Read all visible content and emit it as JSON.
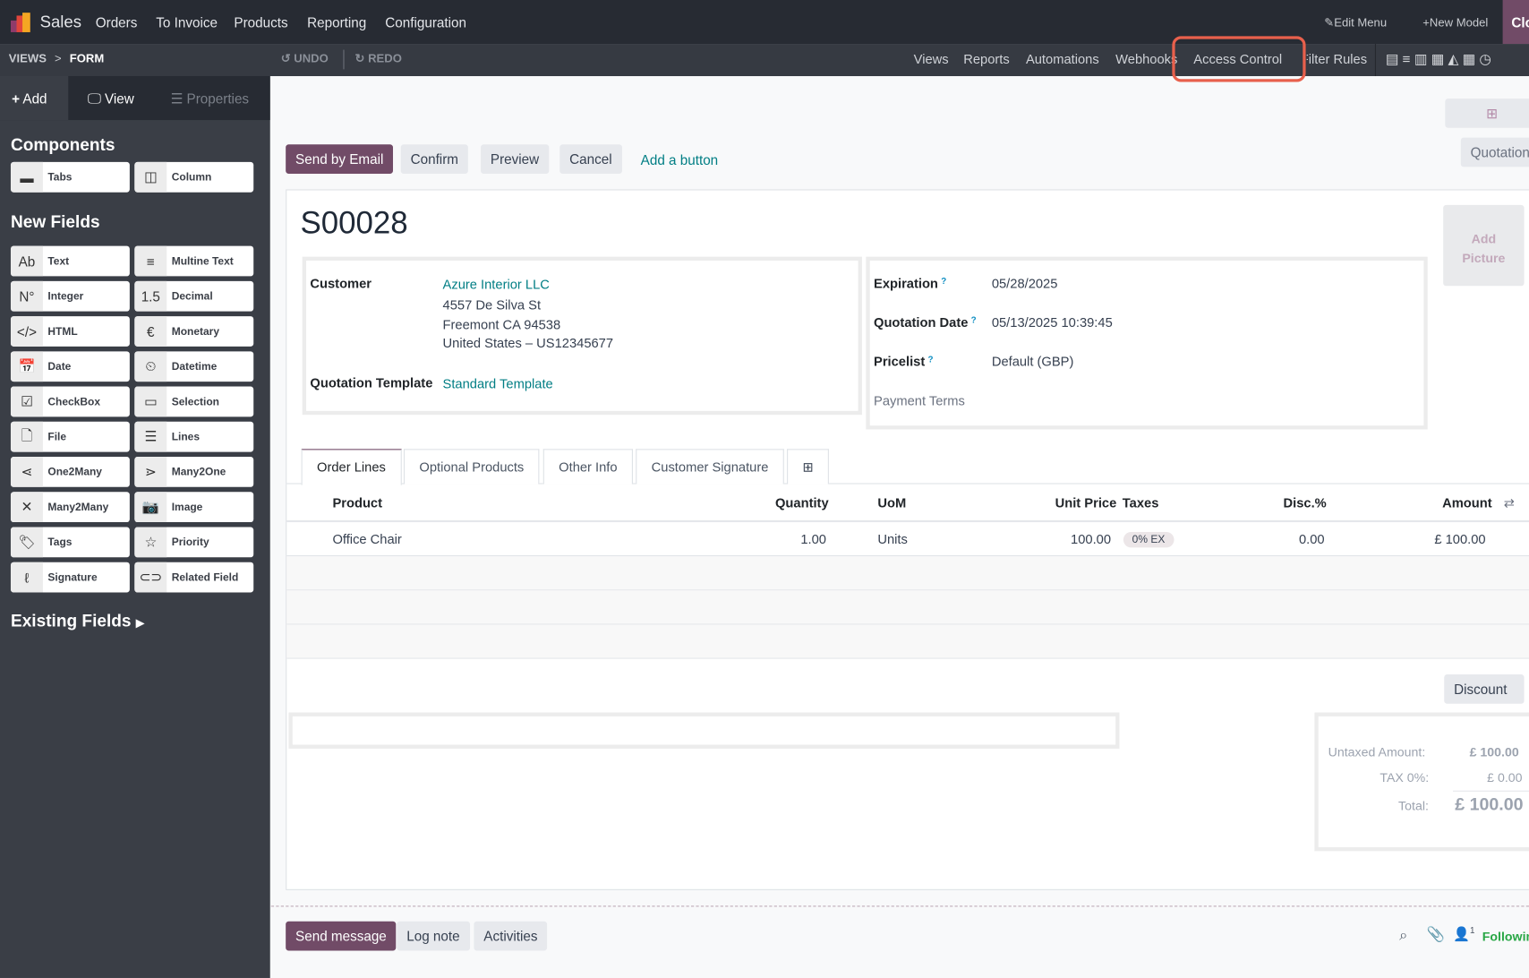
{
  "topbar": {
    "app": "Sales",
    "menu": [
      "Orders",
      "To Invoice",
      "Products",
      "Reporting",
      "Configuration"
    ],
    "edit_menu": "Edit Menu",
    "new_model": "New Model",
    "close": "Close"
  },
  "subbar": {
    "breadcrumb_root": "VIEWS",
    "breadcrumb_sep": ">",
    "breadcrumb_current": "FORM",
    "undo": "UNDO",
    "redo": "REDO",
    "menu": [
      "Views",
      "Reports",
      "Automations",
      "Webhooks",
      "Access Control",
      "Filter Rules"
    ],
    "highlight_color": "#e8604c"
  },
  "sidebar": {
    "tabs": {
      "add": "Add",
      "view": "View",
      "properties": "Properties"
    },
    "components_title": "Components",
    "components": [
      {
        "icon": "tabs-icon",
        "label": "Tabs"
      },
      {
        "icon": "column-icon",
        "label": "Column"
      }
    ],
    "new_fields_title": "New Fields",
    "fields": [
      {
        "icon": "text-icon",
        "label": "Text"
      },
      {
        "icon": "multiline-icon",
        "label": "Multine Text"
      },
      {
        "icon": "integer-icon",
        "label": "Integer"
      },
      {
        "icon": "decimal-icon",
        "label": "Decimal"
      },
      {
        "icon": "html-icon",
        "label": "HTML"
      },
      {
        "icon": "euro-icon",
        "label": "Monetary"
      },
      {
        "icon": "calendar-icon",
        "label": "Date"
      },
      {
        "icon": "clock-icon",
        "label": "Datetime"
      },
      {
        "icon": "checkbox-icon",
        "label": "CheckBox"
      },
      {
        "icon": "selection-icon",
        "label": "Selection"
      },
      {
        "icon": "file-icon",
        "label": "File"
      },
      {
        "icon": "list-icon",
        "label": "Lines"
      },
      {
        "icon": "one2many-icon",
        "label": "One2Many"
      },
      {
        "icon": "many2one-icon",
        "label": "Many2One"
      },
      {
        "icon": "many2many-icon",
        "label": "Many2Many"
      },
      {
        "icon": "camera-icon",
        "label": "Image"
      },
      {
        "icon": "tag-icon",
        "label": "Tags"
      },
      {
        "icon": "star-icon",
        "label": "Priority"
      },
      {
        "icon": "signature-icon",
        "label": "Signature"
      },
      {
        "icon": "link-icon",
        "label": "Related Field"
      }
    ],
    "existing_fields": "Existing Fields"
  },
  "actions": {
    "send_email": "Send by Email",
    "confirm": "Confirm",
    "preview": "Preview",
    "cancel": "Cancel",
    "add_button": "Add a button",
    "quotation": "Quotation",
    "primary_color": "#714b67"
  },
  "form": {
    "title": "S00028",
    "add_picture": [
      "Add",
      "Picture"
    ],
    "customer_label": "Customer",
    "customer": "Azure Interior LLC",
    "address": [
      "4557 De Silva St",
      "Freemont CA 94538",
      "United States – US12345677"
    ],
    "template_label": "Quotation Template",
    "template": "Standard Template",
    "expiration_label": "Expiration",
    "expiration": "05/28/2025",
    "qdate_label": "Quotation Date",
    "qdate": "05/13/2025 10:39:45",
    "pricelist_label": "Pricelist",
    "pricelist": "Default (GBP)",
    "payment_terms_label": "Payment Terms",
    "help": "?"
  },
  "tabs": [
    "Order Lines",
    "Optional Products",
    "Other Info",
    "Customer Signature"
  ],
  "table": {
    "headers": {
      "product": "Product",
      "quantity": "Quantity",
      "uom": "UoM",
      "unit_price": "Unit Price",
      "taxes": "Taxes",
      "disc": "Disc.%",
      "amount": "Amount"
    },
    "rows": [
      {
        "product": "Office Chair",
        "quantity": "1.00",
        "uom": "Units",
        "unit_price": "100.00",
        "taxes": "0% EX",
        "disc": "0.00",
        "amount": "£ 100.00"
      }
    ]
  },
  "totals": {
    "discount": "Discount",
    "untaxed_label": "Untaxed Amount:",
    "untaxed": "£ 100.00",
    "tax_label": "TAX 0%:",
    "tax": "£ 0.00",
    "total_label": "Total:",
    "total": "£ 100.00"
  },
  "chatter": {
    "send_message": "Send message",
    "log_note": "Log note",
    "activities": "Activities",
    "followers_count": "1",
    "following": "Following"
  }
}
